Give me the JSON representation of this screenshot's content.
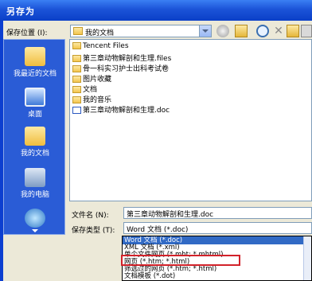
{
  "window": {
    "title": "另存为"
  },
  "save_in": {
    "label": "保存位置 (I):",
    "value": "我的文档"
  },
  "places": [
    {
      "label": "我最近的文档"
    },
    {
      "label": "桌面"
    },
    {
      "label": "我的文档"
    },
    {
      "label": "我的电脑"
    },
    {
      "label": ""
    }
  ],
  "files": [
    {
      "name": "Tencent Files",
      "type": "folder"
    },
    {
      "name": "第三章动物解剖和生理.files",
      "type": "folder"
    },
    {
      "name": "骨一科实习护士出科考试卷",
      "type": "folder"
    },
    {
      "name": "图片收藏",
      "type": "folder"
    },
    {
      "name": "文档",
      "type": "folder"
    },
    {
      "name": "我的音乐",
      "type": "folder"
    },
    {
      "name": "第三章动物解剖和生理.doc",
      "type": "doc"
    }
  ],
  "filename": {
    "label": "文件名 (N):",
    "value": "第三章动物解剖和生理.doc"
  },
  "filetype": {
    "label": "保存类型 (T):",
    "value": "Word 文档 (*.doc)"
  },
  "filetype_options": [
    "Word 文档 (*.doc)",
    "XML 文档 (*.xml)",
    "单个文件网页 (*.mht; *.mhtml)",
    "网页 (*.htm; *.html)",
    "筛选过的网页 (*.htm; *.html)",
    "文档模板 (*.dot)"
  ],
  "colors": {
    "highlight": "#d2222a",
    "selection": "#316ac5"
  }
}
